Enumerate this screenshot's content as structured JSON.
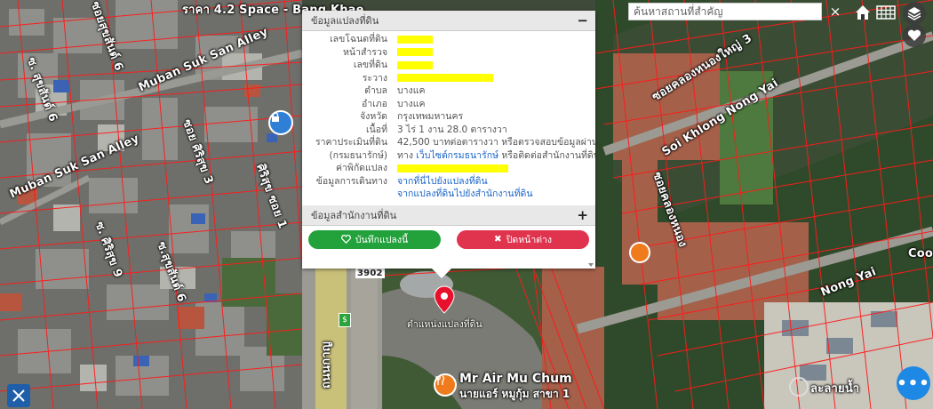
{
  "search": {
    "placeholder": "ค้นหาสถานที่สำคัญ",
    "clear_label": "×"
  },
  "map_labels": {
    "top_sign": "Space - Bang Khae",
    "top_sign_prefix": "ราคา 4.2",
    "alley_1": "Muban Suk San Alley",
    "alley_2": "Muban Suk San Alley",
    "road_right": "Soi Khlong Nong Yai",
    "road_right_thai": "ซอยคลองหนองใหญ่ 3",
    "road_right_2": "Nong Yai",
    "road_right_3": "Coo",
    "soi_left_1": "ซอยสุขสันต์ 6",
    "soi_left_2": "ซ. สุขสันต์ 6",
    "soi_left_3": "ซ. ศิริสุข 9",
    "soi_left_4": "ซอย ศิริสุข 3",
    "soi_left_5": "ซ.สุขสันต์ 6",
    "soi_left_6": "ศิริสุข ซอย 1",
    "soi_mid": "ซอยคลองหนอง",
    "road_number": "3902",
    "road_vertical": "ถนนกาญ",
    "poi_name": "Mr Air Mu Chum",
    "poi_sub": "นายแอร์ หมูกุ้ม สาขา 1",
    "corner_label": "ละลายน้ำ"
  },
  "panel": {
    "header": "ข้อมูลแปลงที่ดิน",
    "header_toggle": "−",
    "rows": [
      {
        "key": "เลขโฉนดที่ดิน",
        "value": ""
      },
      {
        "key": "หน้าสำรวจ",
        "value": ""
      },
      {
        "key": "เลขที่ดิน",
        "value": ""
      },
      {
        "key": "ระวาง",
        "value": ""
      },
      {
        "key": "ตำบล",
        "value": "บางแค"
      },
      {
        "key": "อำเภอ",
        "value": "บางแค"
      },
      {
        "key": "จังหวัด",
        "value": "กรุงเทพมหานคร"
      },
      {
        "key": "เนื้อที่",
        "value": "3 ไร่ 1 งาน 28.0 ตารางวา"
      },
      {
        "key": "ราคาประเมินที่ดิน",
        "value": "42,500 บาทต่อตารางวา หรือตรวจสอบข้อมูลผ่าน"
      },
      {
        "key": "(กรมธนารักษ์)",
        "value_prefix": "ทาง ",
        "value_link": "เว็บไซต์กรมธนารักษ์",
        "value_suffix": " หรือติดต่อสำนักงานที่ดิน"
      },
      {
        "key": "ค่าพิกัดแปลง",
        "value": ""
      },
      {
        "key": "ข้อมูลการเดินทาง",
        "value_link": "จากที่นี่ไปยังแปลงที่ดิน"
      },
      {
        "key": "",
        "value_link": "จากแปลงที่ดินไปยังสำนักงานที่ดิน"
      }
    ],
    "highlight_widths": [
      40,
      40,
      40,
      108,
      0,
      0,
      0,
      0,
      0,
      0,
      125,
      0,
      0
    ],
    "header2": "ข้อมูลสำนักงานที่ดิน",
    "header2_toggle": "+",
    "save_label": "บันทึกแปลงนี้",
    "close_label": "ปิดหน้าต่าง"
  },
  "pin_label": "ตำแหน่งแปลงที่ดิน",
  "chat_label": "•••",
  "colors": {
    "parcel_line": "#ff1a1a",
    "highlight": "#ffff00",
    "save_green": "#23a23c",
    "close_red": "#e0344e",
    "link_blue": "#1a64c8",
    "pin_red": "#e8112d"
  }
}
